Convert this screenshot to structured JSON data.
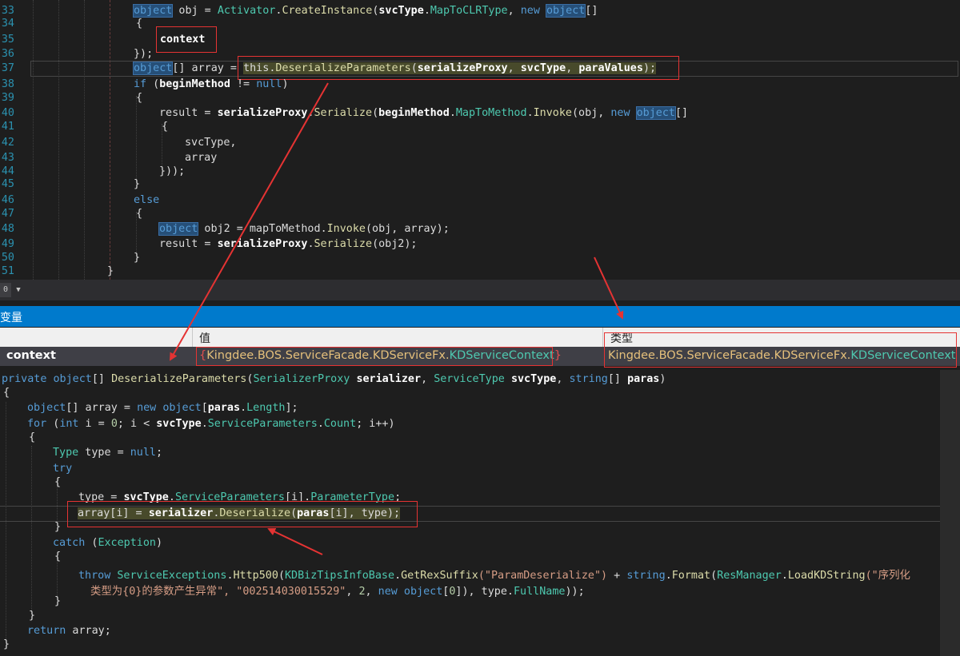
{
  "top_editor": {
    "line_numbers": [
      "33",
      "34",
      "35",
      "36",
      "37",
      "38",
      "39",
      "40",
      "41",
      "42",
      "43",
      "44",
      "45",
      "46",
      "47",
      "48",
      "49",
      "50",
      "51"
    ],
    "line33": {
      "obj_kw": "object",
      "t1": " obj = ",
      "activator": "Activator",
      "dot": ".",
      "create": "CreateInstance",
      "paren": "(",
      "svctype": "svcType",
      "dot2": ".",
      "maptoclr": "MapToCLRType",
      "comma": ", ",
      "new": "new",
      "sp": " ",
      "obj2": "object",
      "brackets": "[]"
    },
    "line34": "{",
    "line35_label": "context",
    "line36": "});",
    "line37": {
      "obj_kw": "object",
      "t1": "[] array = ",
      "this": "this",
      "dot": ".",
      "method": "DeserializeParameters",
      "open": "(",
      "a1": "serializeProxy",
      "c1": ", ",
      "a2": "svcType",
      "c2": ", ",
      "a3": "paraValues",
      "close": ");"
    },
    "line38": {
      "if": "if",
      "t1": " (",
      "var": "beginMethod",
      "t2": " != ",
      "null": "null",
      "t3": ")"
    },
    "line39": "{",
    "line40": {
      "t1": "result = ",
      "var": "serializeProxy",
      "dot": ".",
      "ser": "Serialize",
      "open": "(",
      "bm": "beginMethod",
      "dot2": ".",
      "mtm": "MapToMethod",
      "dot3": ".",
      "inv": "Invoke",
      "t2": "(obj, ",
      "new": "new",
      "sp": " ",
      "obj": "object",
      "br": "[]"
    },
    "line41": "{",
    "line42": "svcType,",
    "line43": "array",
    "line44": "}));",
    "line45": "}",
    "line46": "else",
    "line47": "{",
    "line48": {
      "obj": "object",
      "t1": " obj2 = ",
      "mtm": "mapToMethod",
      "dot": ".",
      "inv": "Invoke",
      "t2": "(obj, array);"
    },
    "line49": {
      "t1": "result = ",
      "var": "serializeProxy",
      "dot": ".",
      "ser": "Serialize",
      "t2": "(obj2);"
    },
    "line50": "}",
    "line51": "}"
  },
  "scrollbar": {
    "zoom_button": "0",
    "dropdown_icon": "▼"
  },
  "locals": {
    "title": "变量",
    "col_value": "值",
    "col_type": "类型",
    "row_name": "context",
    "row_value_parts": [
      "{",
      "Kingdee",
      ".BOS.",
      "ServiceFacade",
      ".",
      "KDServiceFx",
      ".",
      "KDServiceContext",
      "}"
    ],
    "row_type_parts": [
      "Kingdee",
      ".BOS.",
      "ServiceFacade",
      ".",
      "KDServiceFx",
      ".",
      "KDServiceContext"
    ]
  },
  "bottom_editor": {
    "l1": {
      "private": "private",
      "sp": " ",
      "object": "object",
      "br": "[] ",
      "method": "DeserializeParameters",
      "open": "(",
      "spt": "SerializerProxy",
      "sp2": " ",
      "p1": "serializer",
      "c1": ", ",
      "st": "ServiceType",
      "sp3": " ",
      "p2": "svcType",
      "c2": ", ",
      "string": "string",
      "br2": "[] ",
      "p3": "paras",
      "close": ")"
    },
    "l2": "{",
    "l3": {
      "object": "object",
      "t1": "[] array = ",
      "new": "new",
      "sp": " ",
      "object2": "object",
      "t2": "[",
      "paras": "paras",
      "dot": ".",
      "length": "Length",
      "t3": "];"
    },
    "l4": {
      "for": "for",
      "t1": " (",
      "int": "int",
      "t2": " i = ",
      "zero": "0",
      "t3": "; i < ",
      "svctype": "svcType",
      "dot": ".",
      "sp": "ServiceParameters",
      "dot2": ".",
      "count": "Count",
      "t4": "; i++)"
    },
    "l5": "{",
    "l6": {
      "type": "Type",
      "t1": " type = ",
      "null": "null",
      "t2": ";"
    },
    "l7": "try",
    "l8": "{",
    "l9": {
      "t1": "type = ",
      "svctype": "svcType",
      "dot": ".",
      "sp": "ServiceParameters",
      "t2": "[i].",
      "pt": "ParameterType",
      "t3": ";"
    },
    "l10": {
      "t1": "array[i] = ",
      "ser": "serializer",
      "dot": ".",
      "des": "Deserialize",
      "open": "(",
      "paras": "paras",
      "t2": "[i], type);"
    },
    "l11": "}",
    "l12": {
      "catch": "catch",
      "t1": " (",
      "exc": "Exception",
      "t2": ")"
    },
    "l13": "{",
    "l14": {
      "throw": "throw",
      "sp": " ",
      "se": "ServiceExceptions",
      "dot": ".",
      "h500": "Http500",
      "open": "(",
      "kdb": "KDBizTipsInfoBase",
      "dot2": ".",
      "grs": "GetRexSuffix",
      "str1": "(\"ParamDeserialize\")",
      "plus": " + ",
      "string": "string",
      "dot3": ".",
      "format": "Format",
      "open2": "(",
      "rm": "ResManager",
      "dot4": ".",
      "lks": "LoadKDString",
      "str2": "(\"序列化"
    },
    "l15": {
      "str": "类型为{0}的参数产生异常\", \"002514030015529\"",
      "t1": ", ",
      "two": "2",
      "t2": ", ",
      "new": "new",
      "sp": " ",
      "object": "object",
      "t3": "[",
      "zero": "0",
      "t4": "]), type.",
      "fn": "FullName",
      "t5": "));"
    },
    "l16": "}",
    "l17": "}",
    "l18": {
      "ret": "return",
      "t1": " array;"
    },
    "l19": "}"
  },
  "colors": {
    "accent": "#007acc",
    "annotation": "#e53333"
  }
}
